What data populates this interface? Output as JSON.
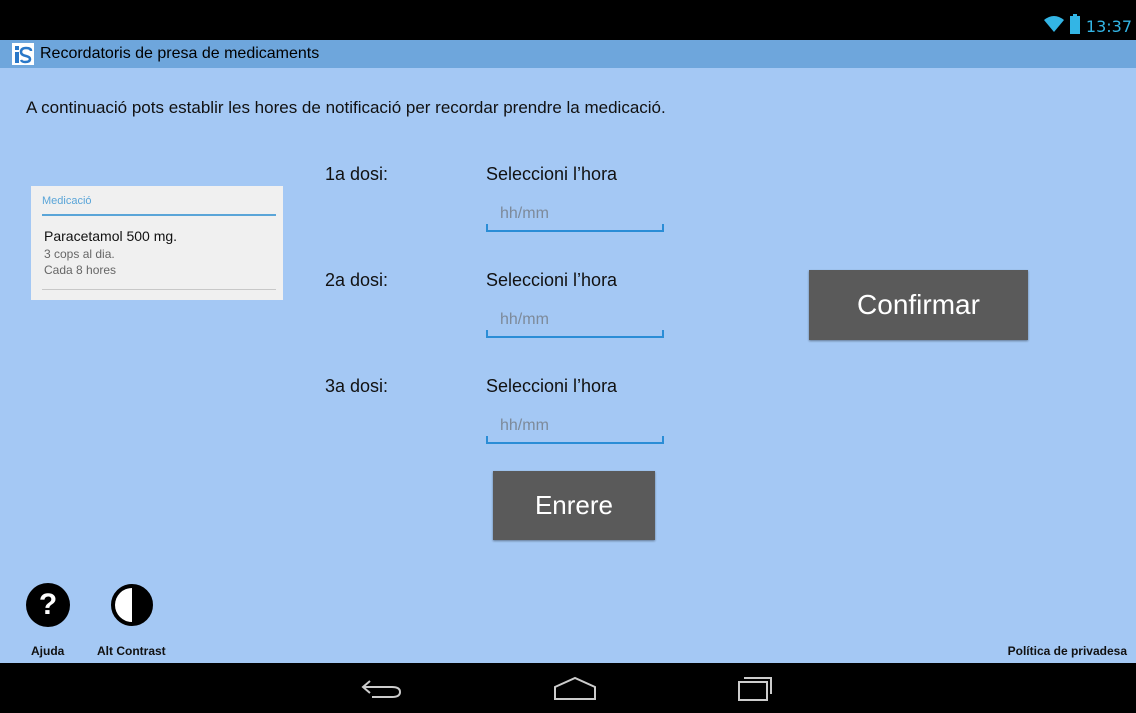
{
  "status_bar": {
    "time": "13:37",
    "icons": [
      "wifi-icon",
      "battery-icon"
    ],
    "icon_color": "#33b5e5"
  },
  "action_bar": {
    "title": "Recordatoris de presa de medicaments",
    "app_icon": "app-logo-icon",
    "color": "#6ea6dc"
  },
  "main": {
    "intro": "A continuació pots establir les hores de notificació per recordar prendre la medicació.",
    "background": "#a4c8f4",
    "medication_card": {
      "title": "Medicació",
      "name": "Paracetamol 500 mg.",
      "frequency": "3 cops al dia.",
      "interval": "Cada 8 hores"
    },
    "doses": [
      {
        "label": "1a dosi:",
        "select_label": "Seleccioni l’hora",
        "placeholder": "hh/mm",
        "value": ""
      },
      {
        "label": "2a dosi:",
        "select_label": "Seleccioni l’hora",
        "placeholder": "hh/mm",
        "value": ""
      },
      {
        "label": "3a dosi:",
        "select_label": "Seleccioni l’hora",
        "placeholder": "hh/mm",
        "value": ""
      }
    ],
    "confirm_label": "Confirmar",
    "back_label": "Enrere",
    "button_color": "#5a5a5a"
  },
  "footer": {
    "help_label": "Ajuda",
    "help_icon": "question-icon",
    "contrast_label": "Alt Contrast",
    "contrast_icon": "contrast-icon",
    "privacy_label": "Política de privadesa"
  },
  "nav_bar": {
    "buttons": [
      "back-icon",
      "home-icon",
      "recent-apps-icon"
    ]
  }
}
